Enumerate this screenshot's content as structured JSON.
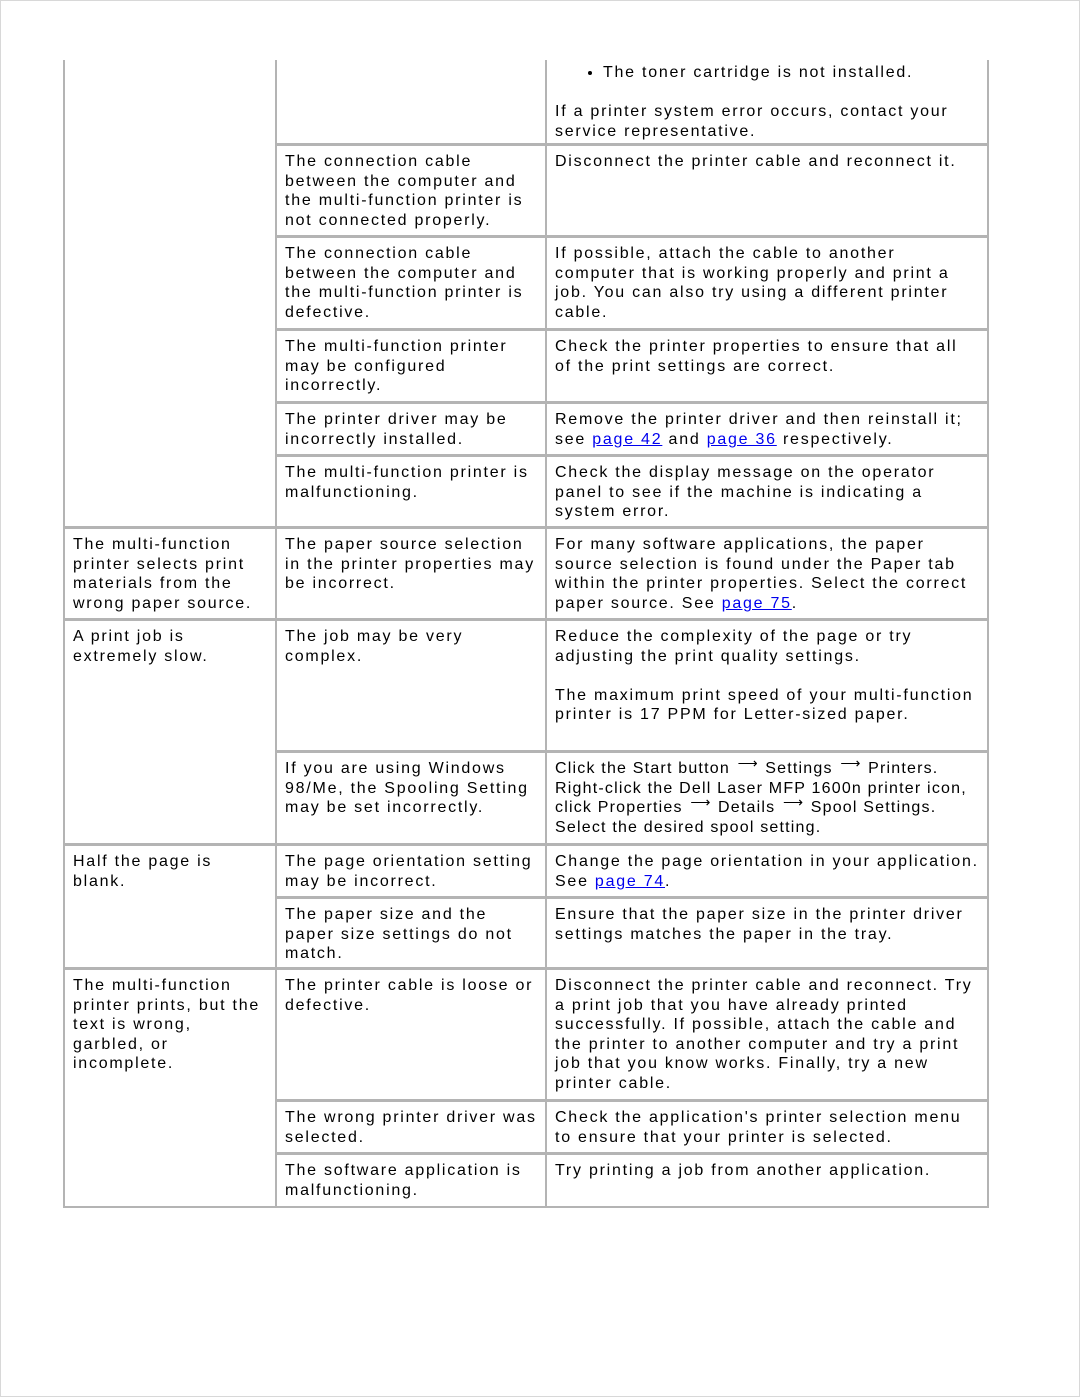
{
  "table": {
    "cells": [
      {
        "col": 0,
        "row_start": 0,
        "row_end": 6,
        "paragraphs": []
      },
      {
        "col": 1,
        "row_start": 0,
        "row_end": 1,
        "paragraphs": []
      },
      {
        "col": 2,
        "row_start": 0,
        "row_end": 1,
        "bullets": [
          "The toner cartridge is not installed."
        ],
        "paragraphs": [
          [
            {
              "t": "If a printer system error occurs, contact your service representative."
            }
          ]
        ]
      },
      {
        "col": 1,
        "row_start": 1,
        "row_end": 2,
        "paragraphs": [
          [
            {
              "t": "The connection cable between the computer and the multi-function printer is not connected properly."
            }
          ]
        ]
      },
      {
        "col": 2,
        "row_start": 1,
        "row_end": 2,
        "paragraphs": [
          [
            {
              "t": "Disconnect the printer cable and reconnect it."
            }
          ]
        ]
      },
      {
        "col": 1,
        "row_start": 2,
        "row_end": 3,
        "paragraphs": [
          [
            {
              "t": "The connection cable between the computer and the multi-function printer is defective."
            }
          ]
        ]
      },
      {
        "col": 2,
        "row_start": 2,
        "row_end": 3,
        "paragraphs": [
          [
            {
              "t": "If possible, attach the cable to another computer that is working properly and print a job. You can also try using a different printer cable."
            }
          ]
        ]
      },
      {
        "col": 1,
        "row_start": 3,
        "row_end": 4,
        "paragraphs": [
          [
            {
              "t": "The multi-function printer may be configured incorrectly."
            }
          ]
        ]
      },
      {
        "col": 2,
        "row_start": 3,
        "row_end": 4,
        "paragraphs": [
          [
            {
              "t": "Check the printer properties to ensure that all of the print settings are correct."
            }
          ]
        ]
      },
      {
        "col": 1,
        "row_start": 4,
        "row_end": 5,
        "paragraphs": [
          [
            {
              "t": "The printer driver may be incorrectly installed."
            }
          ]
        ]
      },
      {
        "col": 2,
        "row_start": 4,
        "row_end": 5,
        "paragraphs": [
          [
            {
              "t": "Remove the printer driver and then reinstall it; see "
            },
            {
              "t": "page 42",
              "link": true
            },
            {
              "t": " and "
            },
            {
              "t": "page 36",
              "link": true
            },
            {
              "t": " respectively."
            }
          ]
        ]
      },
      {
        "col": 1,
        "row_start": 5,
        "row_end": 6,
        "paragraphs": [
          [
            {
              "t": "The multi-function printer is malfunctioning."
            }
          ]
        ]
      },
      {
        "col": 2,
        "row_start": 5,
        "row_end": 6,
        "paragraphs": [
          [
            {
              "t": "Check the display message on the operator panel to see if the machine is indicating a system error."
            }
          ]
        ]
      },
      {
        "col": 0,
        "row_start": 6,
        "row_end": 7,
        "paragraphs": [
          [
            {
              "t": "The multi-function printer selects print materials from the wrong paper source."
            }
          ]
        ]
      },
      {
        "col": 1,
        "row_start": 6,
        "row_end": 7,
        "paragraphs": [
          [
            {
              "t": "The paper source selection in the printer properties may be incorrect."
            }
          ]
        ]
      },
      {
        "col": 2,
        "row_start": 6,
        "row_end": 7,
        "paragraphs": [
          [
            {
              "t": "For many software applications, the paper source selection is found under the Paper tab within the printer properties. Select the correct paper source. See "
            },
            {
              "t": "page 75",
              "link": true
            },
            {
              "t": "."
            }
          ]
        ]
      },
      {
        "col": 0,
        "row_start": 7,
        "row_end": 9,
        "paragraphs": [
          [
            {
              "t": "A print job is extremely slow."
            }
          ]
        ]
      },
      {
        "col": 1,
        "row_start": 7,
        "row_end": 8,
        "paragraphs": [
          [
            {
              "t": "The job may be very complex."
            }
          ]
        ]
      },
      {
        "col": 2,
        "row_start": 7,
        "row_end": 8,
        "paragraphs": [
          [
            {
              "t": "Reduce the complexity of the page or try adjusting the print quality settings."
            }
          ],
          [
            {
              "t": "The maximum print speed of your multi-function printer is 17 PPM for Letter-sized paper."
            }
          ]
        ]
      },
      {
        "col": 1,
        "row_start": 8,
        "row_end": 9,
        "paragraphs": [
          [
            {
              "t": "If you are using Windows 98/Me, the Spooling Setting may be set incorrectly."
            }
          ]
        ]
      },
      {
        "col": 2,
        "row_start": 8,
        "row_end": 9,
        "narrow": true,
        "paragraphs": [
          [
            {
              "t": "Click the Start button "
            },
            {
              "arrow": true
            },
            {
              "t": " Settings "
            },
            {
              "arrow": true
            },
            {
              "t": " Printers. Right-click the Dell Laser MFP 1600n printer icon, click Properties "
            },
            {
              "arrow": true
            },
            {
              "t": " Details "
            },
            {
              "arrow": true
            },
            {
              "t": " Spool Settings. Select the desired spool setting."
            }
          ]
        ]
      },
      {
        "col": 0,
        "row_start": 9,
        "row_end": 11,
        "paragraphs": [
          [
            {
              "t": "Half the page is blank."
            }
          ]
        ]
      },
      {
        "col": 1,
        "row_start": 9,
        "row_end": 10,
        "paragraphs": [
          [
            {
              "t": "The page orientation setting may be incorrect."
            }
          ]
        ]
      },
      {
        "col": 2,
        "row_start": 9,
        "row_end": 10,
        "paragraphs": [
          [
            {
              "t": "Change the page orientation in your application. See "
            },
            {
              "t": "page 74",
              "link": true
            },
            {
              "t": "."
            }
          ]
        ]
      },
      {
        "col": 1,
        "row_start": 10,
        "row_end": 11,
        "paragraphs": [
          [
            {
              "t": "The paper size and the paper size settings do not match."
            }
          ]
        ]
      },
      {
        "col": 2,
        "row_start": 10,
        "row_end": 11,
        "paragraphs": [
          [
            {
              "t": "Ensure that the paper size in the printer driver settings matches the paper in the tray."
            }
          ]
        ]
      },
      {
        "col": 0,
        "row_start": 11,
        "row_end": 14,
        "paragraphs": [
          [
            {
              "t": "The multi-function printer prints, but the text is wrong, garbled, or incomplete."
            }
          ]
        ]
      },
      {
        "col": 1,
        "row_start": 11,
        "row_end": 12,
        "paragraphs": [
          [
            {
              "t": "The printer cable is loose or defective."
            }
          ]
        ]
      },
      {
        "col": 2,
        "row_start": 11,
        "row_end": 12,
        "paragraphs": [
          [
            {
              "t": "Disconnect the printer cable and reconnect. Try a print job that you have already printed successfully. If possible, attach the cable and the printer to another computer and try a print job that you know works. Finally, try a new printer cable."
            }
          ]
        ]
      },
      {
        "col": 1,
        "row_start": 12,
        "row_end": 13,
        "paragraphs": [
          [
            {
              "t": "The wrong printer driver was selected."
            }
          ]
        ]
      },
      {
        "col": 2,
        "row_start": 12,
        "row_end": 13,
        "paragraphs": [
          [
            {
              "t": "Check the application's printer selection menu to ensure that your printer is selected."
            }
          ]
        ]
      },
      {
        "col": 1,
        "row_start": 13,
        "row_end": 14,
        "paragraphs": [
          [
            {
              "t": "The software application is malfunctioning."
            }
          ]
        ]
      },
      {
        "col": 2,
        "row_start": 13,
        "row_end": 14,
        "paragraphs": [
          [
            {
              "t": "Try printing a job from another application."
            }
          ]
        ]
      }
    ],
    "colors": {
      "border": "#b4b4b4",
      "link": "#0000ee"
    },
    "arrow_icon": "right-arrow-icon"
  }
}
